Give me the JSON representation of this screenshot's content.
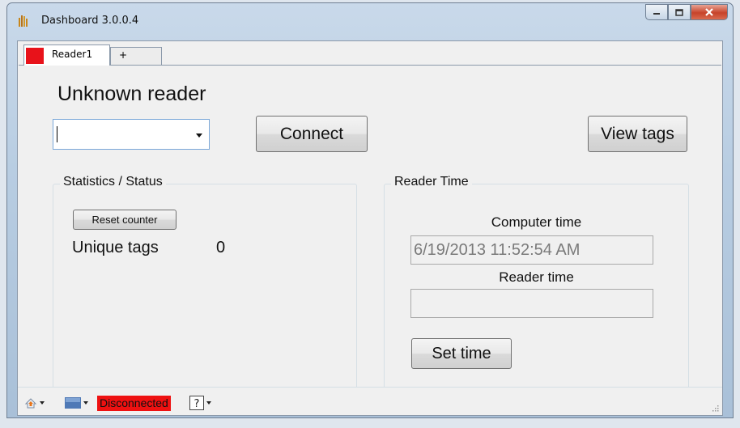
{
  "window": {
    "title": "Dashboard 3.0.0.4",
    "icon": "app-icon",
    "controls": [
      "minimize-icon",
      "maximize-icon",
      "close-icon"
    ]
  },
  "tabs": [
    {
      "label": "Reader1",
      "color": "#e8121a",
      "selected": true
    },
    {
      "label": "+",
      "selected": false
    }
  ],
  "reader": {
    "title": "Unknown reader",
    "combo_value": "",
    "connect_label": "Connect",
    "view_tags_label": "View tags"
  },
  "stats": {
    "legend": "Statistics / Status",
    "reset_label": "Reset counter",
    "unique_tags_label": "Unique tags",
    "unique_tags_value": "0"
  },
  "reader_time": {
    "legend": "Reader Time",
    "computer_time_label": "Computer time",
    "computer_time_value": "6/19/2013 11:52:54 AM",
    "reader_time_label": "Reader time",
    "reader_time_value": "",
    "set_time_label": "Set time"
  },
  "statusbar": {
    "status_text": "Disconnected",
    "status_color": "#ee1111",
    "icons": [
      "connect-icon",
      "device-icon",
      "help-icon"
    ]
  }
}
